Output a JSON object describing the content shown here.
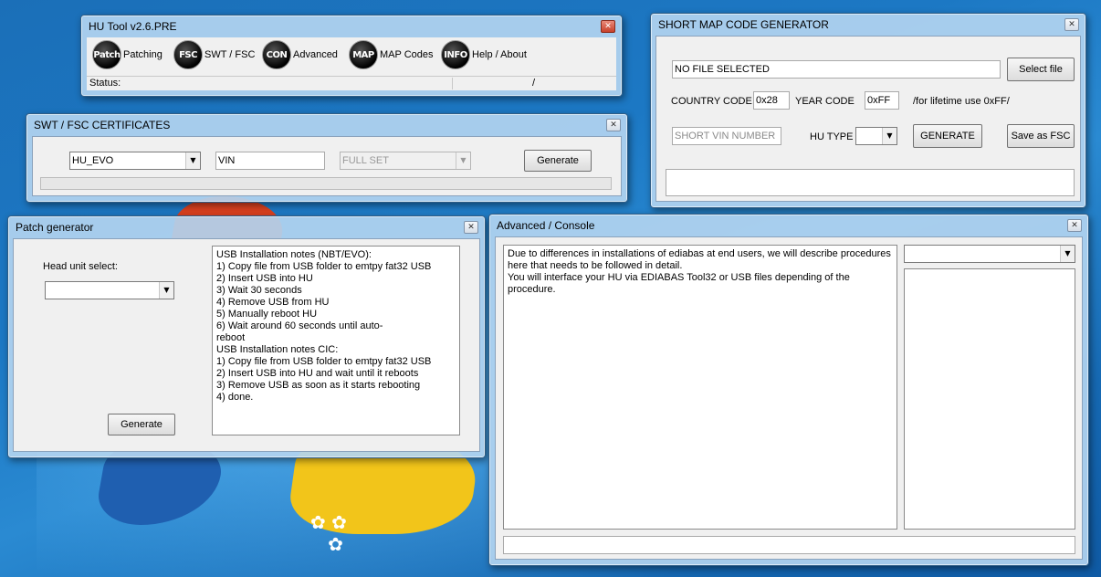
{
  "hu_tool": {
    "title": "HU Tool v2.6.PRE",
    "toolbar": [
      {
        "icon_text": "Patch",
        "label": "Patching"
      },
      {
        "icon_text": "FSC",
        "label": "SWT / FSC"
      },
      {
        "icon_text": "CON",
        "label": "Advanced"
      },
      {
        "icon_text": "MAP",
        "label": "MAP Codes"
      },
      {
        "icon_text": "INFO",
        "label": "Help / About"
      }
    ],
    "status_label": "Status:",
    "status_sep": "/"
  },
  "swt": {
    "title": "SWT / FSC CERTIFICATES",
    "unit_select": "HU_EVO",
    "vin_value": "VIN",
    "set_select": "FULL SET",
    "generate_label": "Generate"
  },
  "patch": {
    "title": "Patch generator",
    "head_unit_label": "Head unit select:",
    "head_unit_value": "",
    "generate_label": "Generate",
    "notes": [
      "USB Installation notes (NBT/EVO):",
      "",
      "1) Copy file from USB folder to emtpy fat32 USB",
      "2) Insert USB into HU",
      "3) Wait 30 seconds",
      "4) Remove USB from HU",
      "5) Manually reboot HU",
      "6) Wait around 60 seconds until auto-",
      "reboot",
      "",
      "USB Installation notes CIC:",
      "1) Copy file from USB folder to emtpy fat32 USB",
      "2) Insert USB into HU and wait until it reboots",
      "3) Remove USB as soon as it starts rebooting",
      "4) done."
    ]
  },
  "smc": {
    "title": "SHORT MAP CODE GENERATOR",
    "file_value": "NO FILE SELECTED",
    "select_file_label": "Select file",
    "country_code_label": "COUNTRY CODE",
    "country_code_value": "0x28",
    "year_code_label": "YEAR CODE",
    "year_code_value": "0xFF",
    "lifetime_note": "/for lifetime use 0xFF/",
    "vin_placeholder": "SHORT VIN NUMBER",
    "hu_type_label": "HU TYPE",
    "hu_type_value": "",
    "generate_label": "GENERATE",
    "save_fsc_label": "Save as FSC"
  },
  "console": {
    "title": "Advanced / Console",
    "text": [
      "Due to differences in installations of ediabas at end users, we will describe procedures",
      "here that needs to be followed in detail.",
      "You will interface your HU via EDIABAS Tool32 or USB files depending of the procedure."
    ],
    "select_value": "",
    "input_value": ""
  }
}
